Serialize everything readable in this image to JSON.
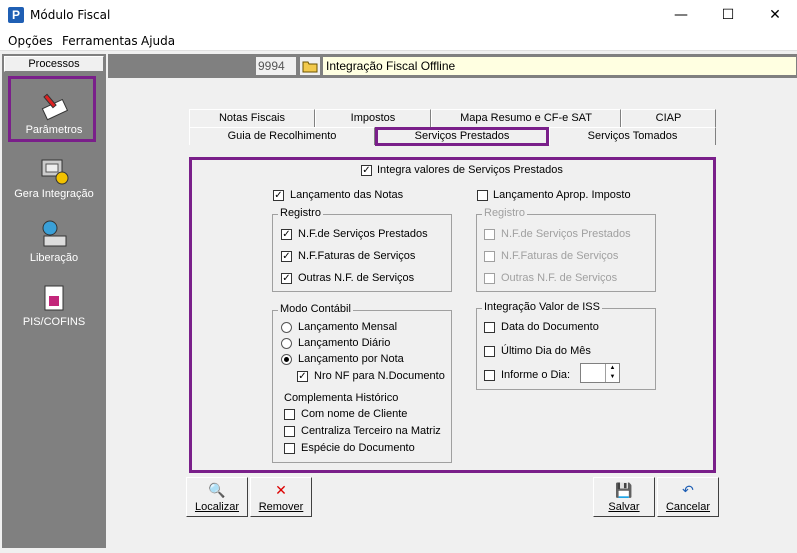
{
  "window": {
    "title": "Módulo Fiscal",
    "minimize": "—",
    "maximize": "☐",
    "close": "✕"
  },
  "menu": [
    "Opções",
    "Ferramentas",
    "Ajuda"
  ],
  "sidebar": {
    "header": "Processos",
    "items": [
      {
        "label": "Parâmetros",
        "icon": "parameters-icon"
      },
      {
        "label": "Gera Integração",
        "icon": "generate-integration-icon"
      },
      {
        "label": "Liberação",
        "icon": "release-icon"
      },
      {
        "label": "PIS/COFINS",
        "icon": "pis-cofins-icon"
      }
    ]
  },
  "top": {
    "code": "9994",
    "title": "Integração Fiscal Offline"
  },
  "tabs_row1": [
    "Notas Fiscais",
    "Impostos",
    "Mapa Resumo e CF-e SAT",
    "CIAP"
  ],
  "tabs_row2": [
    "Guia de Recolhimento",
    "Serviços Prestados",
    "Serviços Tomados"
  ],
  "panel": {
    "integra": "Integra valores de Serviços Prestados",
    "lanc_notas": "Lançamento das Notas",
    "lanc_aprop": "Lançamento Aprop. Imposto",
    "registro_title": "Registro",
    "registro": [
      "N.F.de Serviços Prestados",
      "N.F.Faturas de Serviços",
      "Outras N.F. de Serviços"
    ],
    "registro2_title": "Registro",
    "registro2": [
      "N.F.de Serviços Prestados",
      "N.F.Faturas de Serviços",
      "Outras N.F. de Serviços"
    ],
    "modo_title": "Modo Contábil",
    "modo": [
      "Lançamento Mensal",
      "Lançamento Diário",
      "Lançamento por Nota"
    ],
    "nro_nf": "Nro NF para N.Documento",
    "compl_title": "Complementa Histórico",
    "compl": [
      "Com nome de Cliente",
      "Centraliza Terceiro na Matriz",
      "Espécie do Documento"
    ],
    "iss_title": "Integração Valor de ISS",
    "iss": [
      "Data do Documento",
      "Último Dia do Mês",
      "Informe o Dia:"
    ]
  },
  "buttons": {
    "localizar": "Localizar",
    "remover": "Remover",
    "salvar": "Salvar",
    "cancelar": "Cancelar"
  },
  "colors": {
    "highlight": "#7a1f8a",
    "sidebar": "#808080",
    "title_field": "#ffffe1"
  }
}
